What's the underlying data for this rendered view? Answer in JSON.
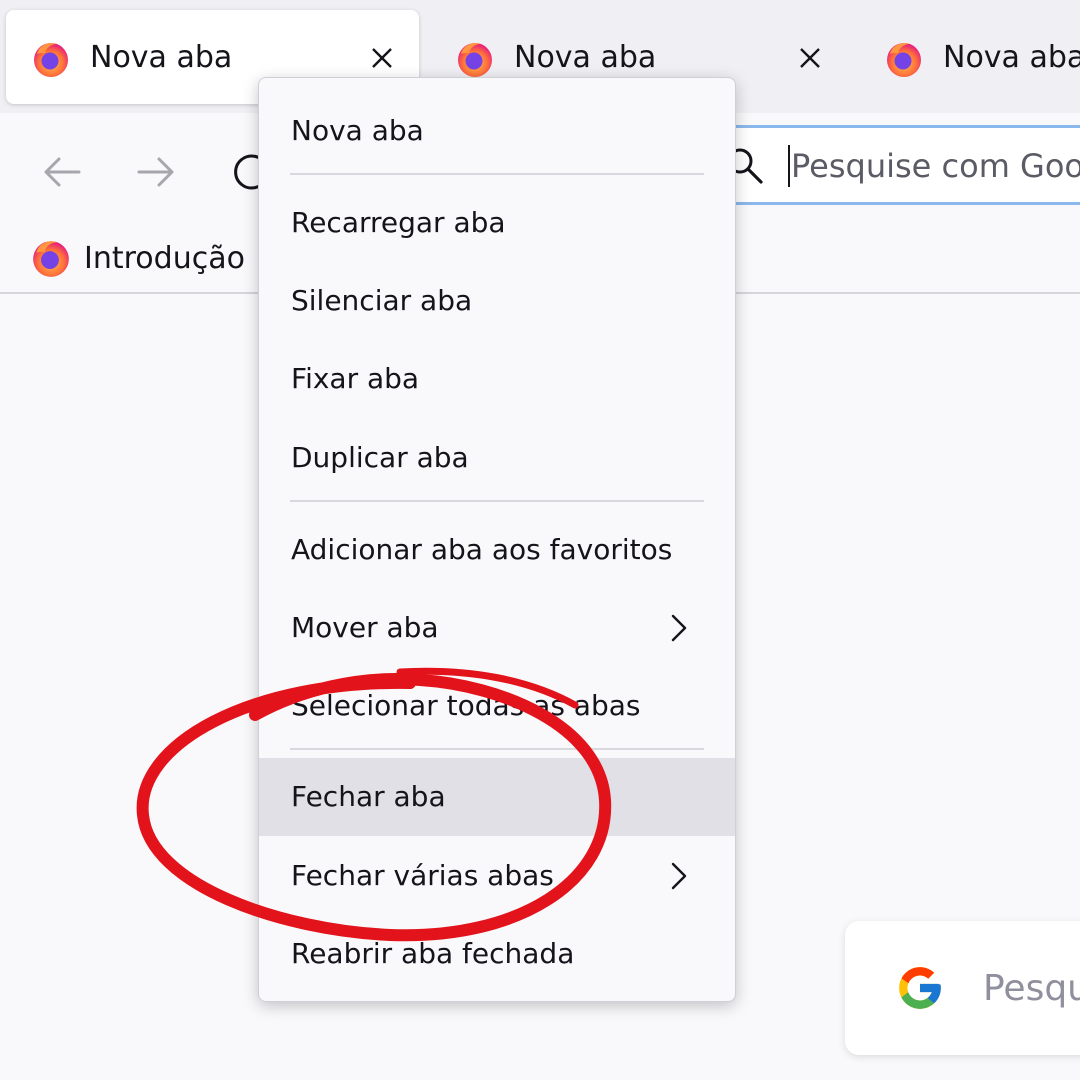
{
  "tabs": [
    {
      "title": "Nova aba",
      "close_icon": "close-icon"
    },
    {
      "title": "Nova aba",
      "close_icon": "close-icon"
    },
    {
      "title": "Nova aba"
    }
  ],
  "urlbar": {
    "placeholder": "Pesquise com Goo"
  },
  "bookmarks": [
    {
      "label": "Introdução"
    }
  ],
  "context_menu": {
    "items": [
      {
        "label": "Nova aba"
      },
      {
        "label": "Recarregar aba"
      },
      {
        "label": "Silenciar aba"
      },
      {
        "label": "Fixar aba"
      },
      {
        "label": "Duplicar aba"
      },
      {
        "label": "Adicionar aba aos favoritos"
      },
      {
        "label": "Mover aba",
        "submenu": true
      },
      {
        "label": "Selecionar todas as abas"
      },
      {
        "label": "Fechar aba",
        "highlighted": true
      },
      {
        "label": "Fechar várias abas",
        "submenu": true
      },
      {
        "label": "Reabrir aba fechada"
      }
    ]
  },
  "search_card": {
    "placeholder": "Pesqu"
  },
  "colors": {
    "annotation": "#e3131b",
    "urlbar_focus": "#8bb8ec",
    "menu_hover": "#e0e0e6"
  }
}
